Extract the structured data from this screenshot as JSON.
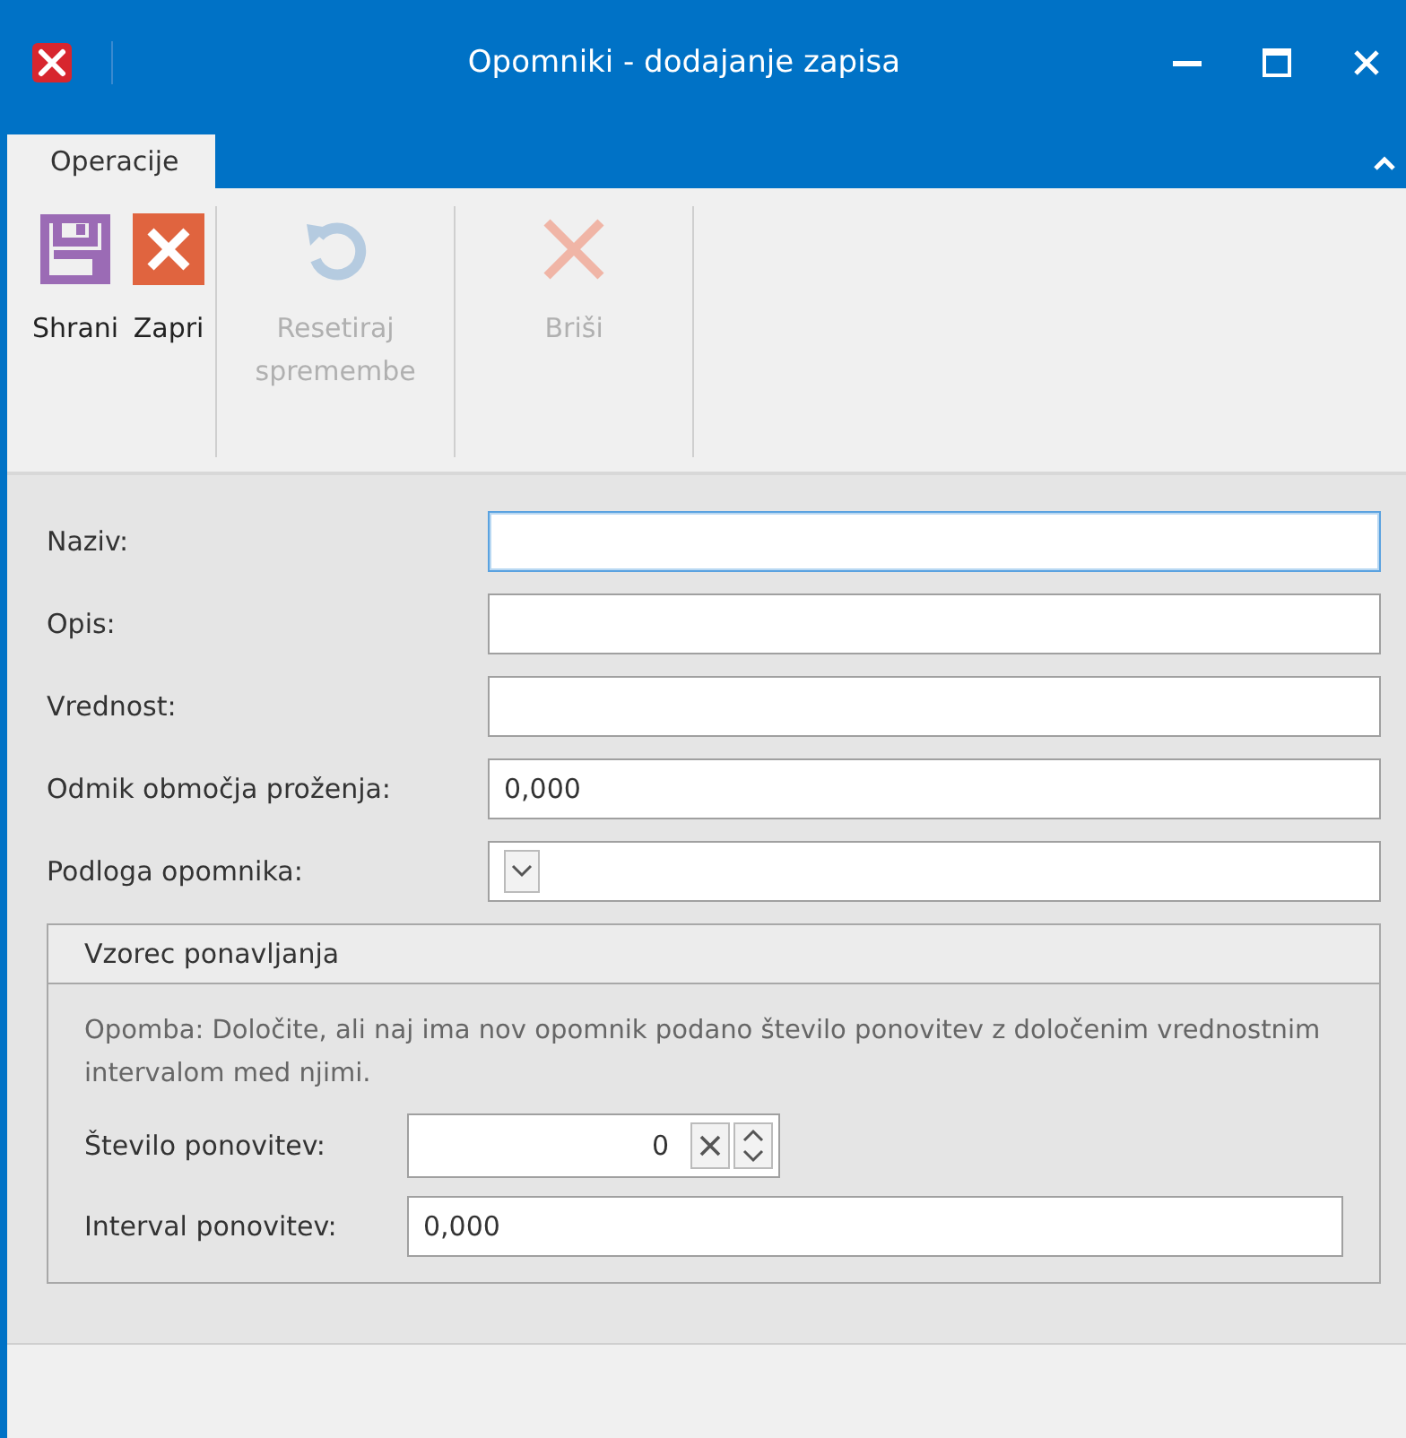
{
  "window": {
    "title": "Opomniki - dodajanje zapisa"
  },
  "tabs": [
    {
      "label": "Operacije",
      "selected": true
    }
  ],
  "toolbar": [
    {
      "kind": "save",
      "label": "Shrani",
      "disabled": false
    },
    {
      "kind": "close",
      "label": "Zapri",
      "disabled": false
    },
    {
      "kind": "reset",
      "label": "Resetiraj spremembe",
      "disabled": true
    },
    {
      "kind": "delete",
      "label": "Briši",
      "disabled": true
    }
  ],
  "fields": [
    {
      "kind": "text",
      "label": "Naziv:",
      "focused": true
    },
    {
      "kind": "text",
      "label": "Opis:",
      "focused": false
    },
    {
      "kind": "text",
      "label": "Vrednost:",
      "focused": false
    },
    {
      "kind": "text",
      "label": "Odmik območja proženja:",
      "value": "0,000",
      "focused": false
    },
    {
      "kind": "dropdown",
      "label": "Podloga opomnika:",
      "focused": false
    }
  ],
  "group": {
    "title": "Vzorec ponavljanja",
    "note": "Opomba: Določite, ali naj ima nov opomnik podano število ponovitev z določenim vrednostnim intervalom med njimi.",
    "fields": [
      {
        "kind": "spinner",
        "label": "Število ponovitev:",
        "value": "0"
      },
      {
        "kind": "text",
        "label": "Interval ponovitev:",
        "value": "0,000"
      }
    ]
  }
}
